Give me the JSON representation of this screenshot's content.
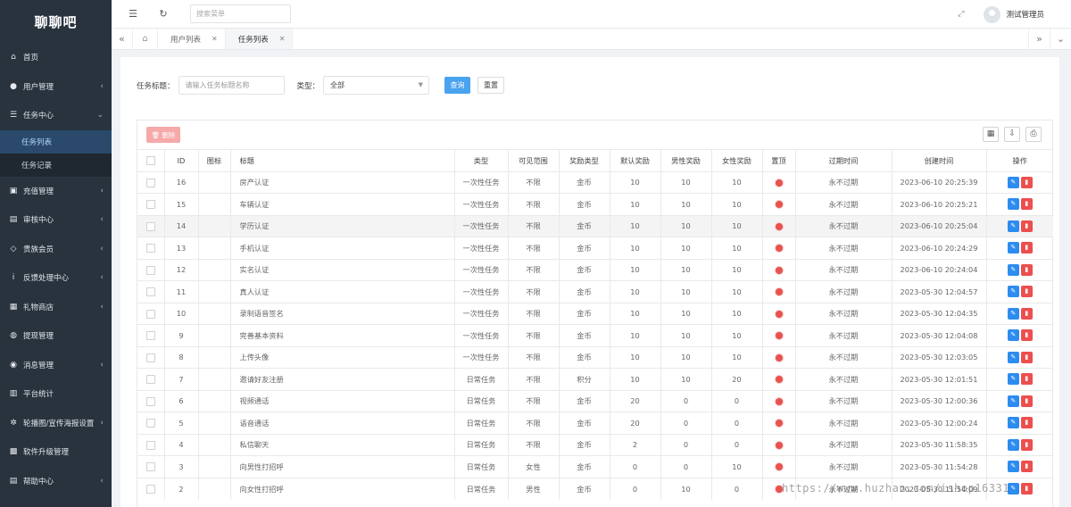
{
  "app": {
    "logo": "聊聊吧"
  },
  "sidebar": {
    "items": [
      {
        "label": "首页",
        "icon": "home-icon",
        "glyph": "⌂"
      },
      {
        "label": "用户管理",
        "icon": "user-icon",
        "glyph": "●",
        "arrow": "‹"
      },
      {
        "label": "任务中心",
        "icon": "list-icon",
        "glyph": "☰",
        "arrow": "⌄"
      },
      {
        "label": "充值管理",
        "icon": "gift-icon",
        "glyph": "▣",
        "arrow": "‹"
      },
      {
        "label": "审核中心",
        "icon": "audit-icon",
        "glyph": "▤",
        "arrow": "‹"
      },
      {
        "label": "贵族会员",
        "icon": "diamond-icon",
        "glyph": "◇",
        "arrow": "‹"
      },
      {
        "label": "反馈处理中心",
        "icon": "info-icon",
        "glyph": "i",
        "arrow": "‹"
      },
      {
        "label": "礼物商店",
        "icon": "shop-icon",
        "glyph": "▦",
        "arrow": "‹"
      },
      {
        "label": "提现管理",
        "icon": "money-icon",
        "glyph": "◍"
      },
      {
        "label": "消息管理",
        "icon": "message-icon",
        "glyph": "◉",
        "arrow": "‹"
      },
      {
        "label": "平台统计",
        "icon": "stats-icon",
        "glyph": "▥"
      },
      {
        "label": "轮播图/宣传海报设置",
        "icon": "settings-icon",
        "glyph": "✲",
        "arrow": "‹"
      },
      {
        "label": "软件升级管理",
        "icon": "upgrade-icon",
        "glyph": "▩"
      },
      {
        "label": "帮助中心",
        "icon": "help-icon",
        "glyph": "▤",
        "arrow": "‹"
      }
    ],
    "submenu": [
      {
        "label": "任务列表"
      },
      {
        "label": "任务记录"
      }
    ]
  },
  "topbar": {
    "search_placeholder": "搜索菜单",
    "user_name": "测试管理员"
  },
  "tabs": [
    {
      "label": "用户列表"
    },
    {
      "label": "任务列表"
    }
  ],
  "filters": {
    "title_label": "任务标题：",
    "title_placeholder": "请输入任务标题名称",
    "type_label": "类型：",
    "type_value": "全部",
    "query_label": "查询",
    "reset_label": "重置"
  },
  "toolbar": {
    "delete_label": "删除"
  },
  "table": {
    "headers": [
      "ID",
      "图标",
      "标题",
      "类型",
      "可见范围",
      "奖励类型",
      "默认奖励",
      "男性奖励",
      "女性奖励",
      "置顶",
      "过期时间",
      "创建时间",
      "操作"
    ],
    "rows": [
      {
        "id": "16",
        "title": "房产认证",
        "type": "一次性任务",
        "scope": "不限",
        "reward_type": "金币",
        "default": "10",
        "male": "10",
        "female": "10",
        "expire": "永不过期",
        "created": "2023-06-10 20:25:39"
      },
      {
        "id": "15",
        "title": "车辆认证",
        "type": "一次性任务",
        "scope": "不限",
        "reward_type": "金币",
        "default": "10",
        "male": "10",
        "female": "10",
        "expire": "永不过期",
        "created": "2023-06-10 20:25:21"
      },
      {
        "id": "14",
        "title": "学历认证",
        "type": "一次性任务",
        "scope": "不限",
        "reward_type": "金币",
        "default": "10",
        "male": "10",
        "female": "10",
        "expire": "永不过期",
        "created": "2023-06-10 20:25:04"
      },
      {
        "id": "13",
        "title": "手机认证",
        "type": "一次性任务",
        "scope": "不限",
        "reward_type": "金币",
        "default": "10",
        "male": "10",
        "female": "10",
        "expire": "永不过期",
        "created": "2023-06-10 20:24:29"
      },
      {
        "id": "12",
        "title": "实名认证",
        "type": "一次性任务",
        "scope": "不限",
        "reward_type": "金币",
        "default": "10",
        "male": "10",
        "female": "10",
        "expire": "永不过期",
        "created": "2023-06-10 20:24:04"
      },
      {
        "id": "11",
        "title": "真人认证",
        "type": "一次性任务",
        "scope": "不限",
        "reward_type": "金币",
        "default": "10",
        "male": "10",
        "female": "10",
        "expire": "永不过期",
        "created": "2023-05-30 12:04:57"
      },
      {
        "id": "10",
        "title": "录制语音签名",
        "type": "一次性任务",
        "scope": "不限",
        "reward_type": "金币",
        "default": "10",
        "male": "10",
        "female": "10",
        "expire": "永不过期",
        "created": "2023-05-30 12:04:35"
      },
      {
        "id": "9",
        "title": "完善基本资料",
        "type": "一次性任务",
        "scope": "不限",
        "reward_type": "金币",
        "default": "10",
        "male": "10",
        "female": "10",
        "expire": "永不过期",
        "created": "2023-05-30 12:04:08"
      },
      {
        "id": "8",
        "title": "上传头像",
        "type": "一次性任务",
        "scope": "不限",
        "reward_type": "金币",
        "default": "10",
        "male": "10",
        "female": "10",
        "expire": "永不过期",
        "created": "2023-05-30 12:03:05"
      },
      {
        "id": "7",
        "title": "邀请好友注册",
        "type": "日常任务",
        "scope": "不限",
        "reward_type": "积分",
        "default": "10",
        "male": "10",
        "female": "20",
        "expire": "永不过期",
        "created": "2023-05-30 12:01:51"
      },
      {
        "id": "6",
        "title": "视频通话",
        "type": "日常任务",
        "scope": "不限",
        "reward_type": "金币",
        "default": "20",
        "male": "0",
        "female": "0",
        "expire": "永不过期",
        "created": "2023-05-30 12:00:36"
      },
      {
        "id": "5",
        "title": "语音通话",
        "type": "日常任务",
        "scope": "不限",
        "reward_type": "金币",
        "default": "20",
        "male": "0",
        "female": "0",
        "expire": "永不过期",
        "created": "2023-05-30 12:00:24"
      },
      {
        "id": "4",
        "title": "私信聊天",
        "type": "日常任务",
        "scope": "不限",
        "reward_type": "金币",
        "default": "2",
        "male": "0",
        "female": "0",
        "expire": "永不过期",
        "created": "2023-05-30 11:58:35"
      },
      {
        "id": "3",
        "title": "向男性打招呼",
        "type": "日常任务",
        "scope": "女性",
        "reward_type": "金币",
        "default": "0",
        "male": "0",
        "female": "10",
        "expire": "永不过期",
        "created": "2023-05-30 11:54:28"
      },
      {
        "id": "2",
        "title": "向女性打招呼",
        "type": "日常任务",
        "scope": "男性",
        "reward_type": "金币",
        "default": "0",
        "male": "10",
        "female": "0",
        "expire": "永不过期",
        "created": "2023-05-30 11:54:09"
      }
    ]
  },
  "watermark": "https://www.huzhan.com/ishop16331",
  "colors": {
    "sidebar_bg": "#28333e",
    "primary": "#4aa3ee",
    "danger": "#ed4e4e",
    "pin_dot": "#e8524f"
  }
}
